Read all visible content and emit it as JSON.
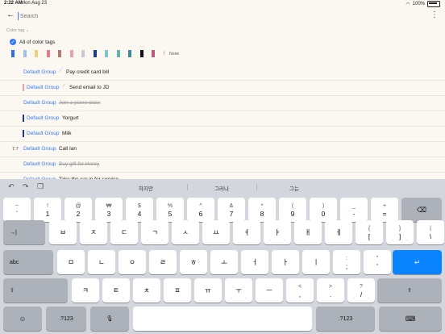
{
  "status": {
    "time": "2:22 AM",
    "date": "Mon Aug 23",
    "battery": "100%"
  },
  "search": {
    "placeholder": "Search"
  },
  "filter": {
    "label": "Color tag",
    "all_label": "All of color tags",
    "none_label": "None"
  },
  "swatch_colors": [
    "#2f6fd6",
    "#9fc2ea",
    "#e9d37a",
    "#e27b86",
    "#b27c6e",
    "#e7a0b3",
    "#c9c9cf",
    "#1e3c8a",
    "#7ec6cf",
    "#5fb3ad",
    "#3a8c9a",
    "#111111",
    "#c05a7d"
  ],
  "tasks": [
    {
      "num": "",
      "bar": "",
      "group": "Default Group",
      "pin": true,
      "text": "Pay credit card bill",
      "done": false
    },
    {
      "num": "",
      "bar": "#e8a2a2",
      "group": "Default Group",
      "pin": true,
      "text": "Send email to JD",
      "done": false
    },
    {
      "num": "",
      "bar": "",
      "group": "Default Group",
      "pin": false,
      "text": "Join a piano class",
      "done": true
    },
    {
      "num": "",
      "bar": "#1e3c8a",
      "group": "Default Group",
      "pin": false,
      "text": "Yorgurt",
      "done": false
    },
    {
      "num": "",
      "bar": "#1e3c8a",
      "group": "Default Group",
      "pin": false,
      "text": "Milk",
      "done": false
    },
    {
      "num": "7.7",
      "bar": "",
      "group": "Default Group",
      "pin": false,
      "text": "Call Ian",
      "done": false
    },
    {
      "num": "",
      "bar": "",
      "group": "Default Group",
      "pin": false,
      "text": "Buy gift for Henry",
      "done": true
    },
    {
      "num": "",
      "bar": "",
      "group": "Default Group",
      "pin": false,
      "text": "Take the car in for service",
      "done": false
    }
  ],
  "predictions": [
    "하지만",
    "그러나",
    "그는"
  ],
  "keyboard": {
    "row1": [
      [
        "~",
        "`"
      ],
      [
        "!",
        "1"
      ],
      [
        "@",
        "2"
      ],
      [
        "₩",
        "3"
      ],
      [
        "$",
        "4"
      ],
      [
        "%",
        "5"
      ],
      [
        "^",
        "6"
      ],
      [
        "&",
        "7"
      ],
      [
        "*",
        "8"
      ],
      [
        "(",
        "9"
      ],
      [
        ")",
        "0"
      ],
      [
        "_",
        "-"
      ],
      [
        "+",
        "="
      ]
    ],
    "row2": [
      "ㅂ",
      "ㅈ",
      "ㄷ",
      "ㄱ",
      "ㅅ",
      "ㅛ",
      "ㅕ",
      "ㅑ",
      "ㅐ",
      "ㅔ"
    ],
    "row2_extra": [
      [
        "{",
        "["
      ],
      [
        "}",
        "]"
      ],
      [
        "|",
        "\\"
      ]
    ],
    "row3": [
      "ㅁ",
      "ㄴ",
      "ㅇ",
      "ㄹ",
      "ㅎ",
      "ㅗ",
      "ㅓ",
      "ㅏ",
      "ㅣ"
    ],
    "row3_extra": [
      [
        ":",
        ";"
      ],
      [
        "\"",
        "'"
      ]
    ],
    "row4": [
      "ㅋ",
      "ㅌ",
      "ㅊ",
      "ㅍ",
      "ㅠ",
      "ㅜ",
      "ㅡ"
    ],
    "row4_extra": [
      [
        "<",
        ","
      ],
      [
        ">",
        "."
      ],
      [
        "?",
        "/"
      ]
    ],
    "tab_label": "→|",
    "caps_label": "abc",
    "shift_label": "⇧",
    "num_label": ".?123",
    "return_label": "↵",
    "delete_label": "⌫",
    "emoji_label": "☺",
    "mic_label": "🎙",
    "hide_label": "⌨"
  }
}
